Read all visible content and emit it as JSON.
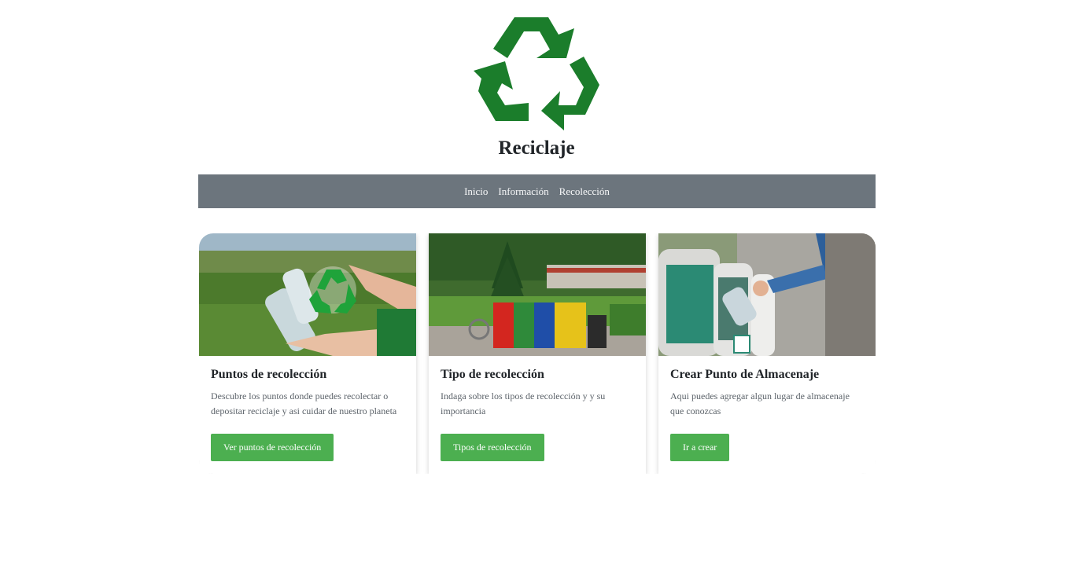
{
  "header": {
    "logo_icon": "recycle-icon",
    "title": "Reciclaje"
  },
  "nav": {
    "items": [
      {
        "label": "Inicio"
      },
      {
        "label": "Información"
      },
      {
        "label": "Recolección"
      }
    ]
  },
  "cards": [
    {
      "image": "hands-plastic-bottles-recycle-photo",
      "title": "Puntos de recolección",
      "text": "Descubre los puntos donde puedes recolectar o depositar reciclaje y asi cuidar de nuestro planeta",
      "button": "Ver puntos de recolección"
    },
    {
      "image": "park-recycling-bins-photo",
      "title": "Tipo de recolección",
      "text": "Indaga sobre los tipos de recolección y y su importancia",
      "button": "Tipos de recolección"
    },
    {
      "image": "person-throwing-bottle-bin-photo",
      "title": "Crear Punto de Almacenaje",
      "text": "Aqui puedes agregar algun lugar de almacenaje que conozcas",
      "button": "Ir a crear"
    }
  ],
  "colors": {
    "brand_green": "#1b7d2b",
    "navbar": "#6c757d",
    "button": "#4caf50"
  }
}
